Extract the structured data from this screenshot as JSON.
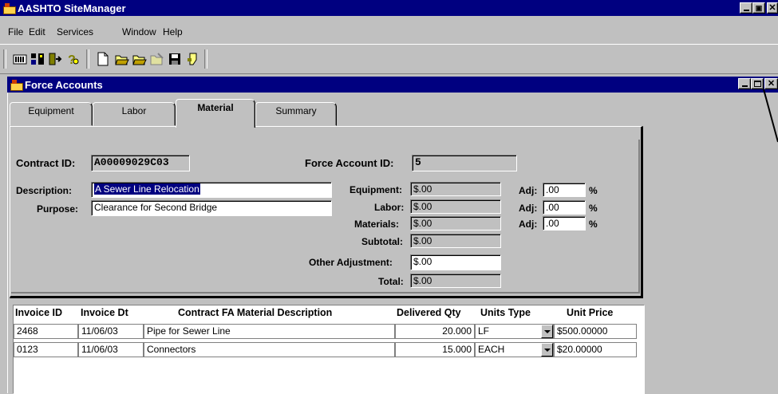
{
  "app": {
    "title": "AASHTO SiteManager"
  },
  "menu": [
    {
      "label": "File"
    },
    {
      "label": "Edit"
    },
    {
      "label": "Services"
    },
    {
      "label": "Window"
    },
    {
      "label": "Help"
    }
  ],
  "toolbar": {
    "icons": [
      "reports-icon",
      "workflow-icon",
      "exit-icon",
      "help-icon",
      "new-icon",
      "open-icon",
      "open-folder-icon",
      "delete-icon",
      "save-icon",
      "services-icon"
    ]
  },
  "child_window": {
    "title": "Force Accounts"
  },
  "tabs": [
    {
      "label": "Equipment"
    },
    {
      "label": "Labor"
    },
    {
      "label": "Material"
    },
    {
      "label": "Summary"
    }
  ],
  "form": {
    "contract_id_label": "Contract ID:",
    "contract_id": "A00009029C03",
    "force_account_id_label": "Force Account ID:",
    "force_account_id": "5",
    "description_label": "Description:",
    "description": "A Sewer Line Relocation",
    "purpose_label": "Purpose:",
    "purpose": "Clearance for Second Bridge",
    "equipment_label": "Equipment:",
    "equipment": "$.00",
    "labor_label": "Labor:",
    "labor": "$.00",
    "materials_label": "Materials:",
    "materials": "$.00",
    "subtotal_label": "Subtotal:",
    "subtotal": "$.00",
    "other_adjustment_label": "Other Adjustment:",
    "other_adjustment": "$.00",
    "total_label": "Total:",
    "total": "$.00",
    "adj_label": "Adj:",
    "adj_equipment": ".00",
    "adj_labor": ".00",
    "adj_materials": ".00",
    "percent": "%"
  },
  "grid": {
    "headers": {
      "invoice_id": "Invoice ID",
      "invoice_dt": "Invoice Dt",
      "description": "Contract FA Material Description",
      "delivered_qty": "Delivered Qty",
      "units_type": "Units Type",
      "unit_price": "Unit Price"
    },
    "rows": [
      {
        "invoice_id": "2468",
        "invoice_dt": "11/06/03",
        "description": "Pipe for Sewer Line",
        "delivered_qty": "20.000",
        "units_type": "LF",
        "unit_price": "$500.00000"
      },
      {
        "invoice_id": "0123",
        "invoice_dt": "11/06/03",
        "description": "Connectors",
        "delivered_qty": "15.000",
        "units_type": "EACH",
        "unit_price": "$20.00000"
      }
    ]
  }
}
